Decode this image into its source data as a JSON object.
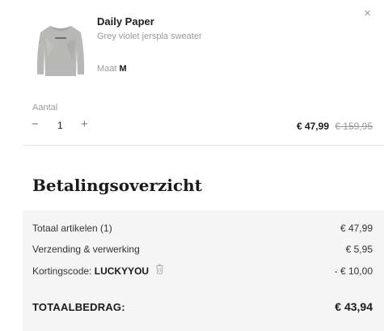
{
  "cart_item": {
    "close_icon": "×",
    "image": "grey-sweater-thumbnail",
    "brand": "Daily Paper",
    "description": "Grey violet jerspla sweater",
    "size_label": "Maat",
    "size_value": "M",
    "quantity_label": "Aantal",
    "quantity_minus": "−",
    "quantity_value": "1",
    "quantity_plus": "+",
    "price_current": "€ 47,99",
    "price_original": "€ 159,95"
  },
  "summary": {
    "title": "Betalingsoverzicht",
    "rows": [
      {
        "label": "Totaal artikelen (1)",
        "value": "€ 47,99"
      },
      {
        "label": "Verzending & verwerking",
        "value": "€ 5,95"
      }
    ],
    "discount": {
      "label": "Kortingscode:",
      "code": "LUCKYYOU",
      "icon": "trash-icon",
      "value": "- € 10,00"
    },
    "total_label": "TOTAALBEDRAG:",
    "total_value": "€ 43,94"
  },
  "colors": {
    "text": "#1a1a1a",
    "muted": "#9a9a9a",
    "summary_bg": "#f5f5f5",
    "divider": "#e6e6e6"
  }
}
